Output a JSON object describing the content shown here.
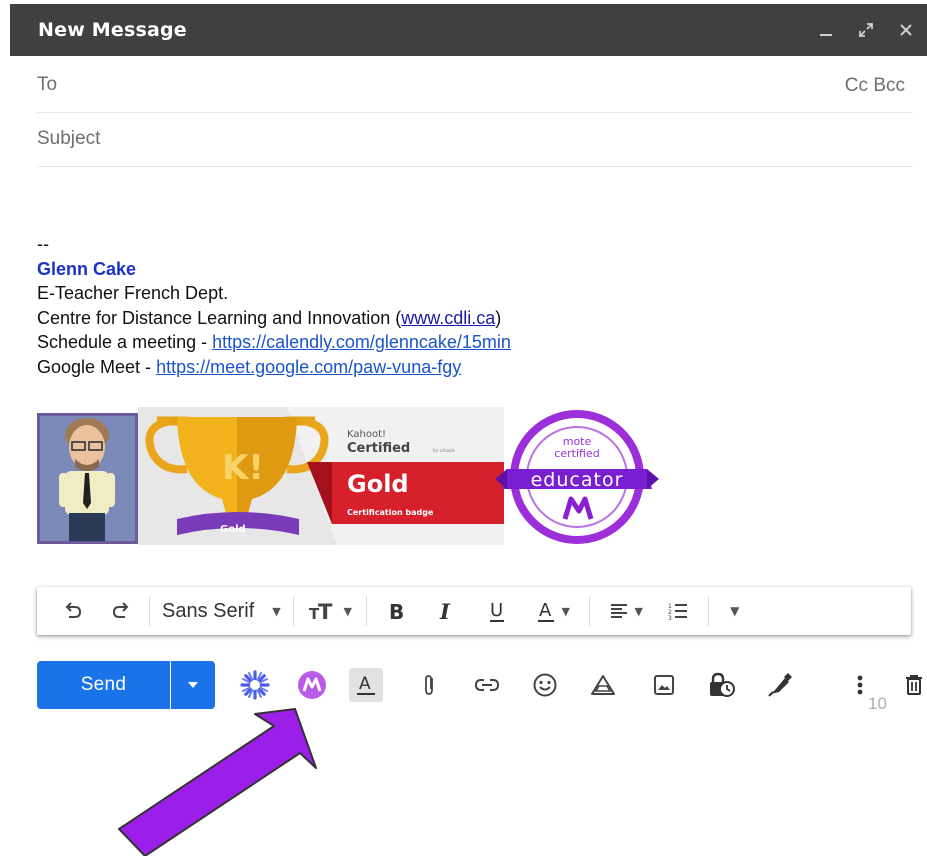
{
  "window": {
    "title": "New Message",
    "controls": [
      "minimize-icon",
      "expand-icon",
      "close-icon"
    ]
  },
  "to": {
    "placeholder": "To",
    "cc": "Cc",
    "bcc": "Bcc"
  },
  "subject": {
    "placeholder": "Subject"
  },
  "signature": {
    "separator": "--",
    "name": "Glenn Cake",
    "role": "E-Teacher French Dept.",
    "org_prefix": "Centre for Distance Learning and Innovation (",
    "org_link": "www.cdli.ca",
    "org_suffix": ")",
    "meeting_prefix": "Schedule a meeting - ",
    "meeting_link": "https://calendly.com/glenncake/15min",
    "meet_prefix": "Google Meet - ",
    "meet_link": "https://meet.google.com/paw-vuna-fgy"
  },
  "badges": {
    "kahoot_brand": "Kahoot!",
    "kahoot_certified": "Certified",
    "kahoot_for": "for schools",
    "kahoot_level": "Gold",
    "kahoot_sub": "Certification badge",
    "trophy_letter": "K!",
    "trophy_ribbon": "Gold",
    "mote_line1": "mote",
    "mote_line2": "certified",
    "mote_word": "educator"
  },
  "format_toolbar": {
    "font": "Sans Serif",
    "icons": [
      "undo-icon",
      "redo-icon",
      "font-size-icon",
      "bold-icon",
      "italic-icon",
      "underline-icon",
      "text-color-icon",
      "align-icon",
      "numbered-list-icon",
      "more-formatting-icon"
    ]
  },
  "compose_toolbar": {
    "send_label": "Send",
    "icons": [
      "send-options-icon",
      "extension-snowflake-icon",
      "mote-extension-icon",
      "formatting-options-icon",
      "attach-icon",
      "link-icon",
      "emoji-icon",
      "drive-icon",
      "photo-icon",
      "confidential-mode-icon",
      "signature-icon",
      "more-options-icon",
      "discard-icon"
    ]
  },
  "overlay": {
    "partial_text": "10"
  },
  "colors": {
    "titlebar": "#404040",
    "send": "#1a73e8",
    "arrow": "#9b1fe8",
    "mote_purple": "#9c2fd9",
    "kahoot_red": "#d6202c",
    "trophy_gold": "#f2b21b"
  }
}
